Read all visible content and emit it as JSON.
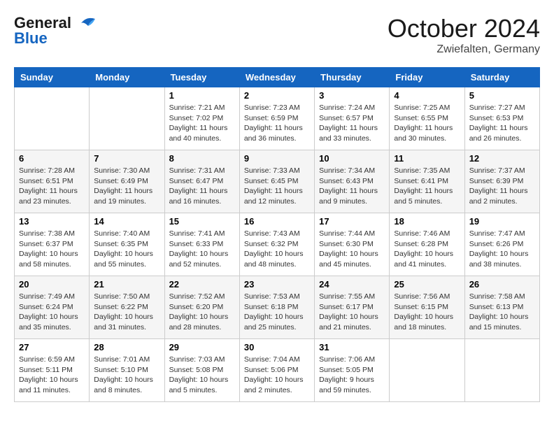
{
  "header": {
    "logo_line1": "General",
    "logo_line2": "Blue",
    "month": "October 2024",
    "location": "Zwiefalten, Germany"
  },
  "days_of_week": [
    "Sunday",
    "Monday",
    "Tuesday",
    "Wednesday",
    "Thursday",
    "Friday",
    "Saturday"
  ],
  "weeks": [
    [
      {
        "day": "",
        "info": ""
      },
      {
        "day": "",
        "info": ""
      },
      {
        "day": "1",
        "info": "Sunrise: 7:21 AM\nSunset: 7:02 PM\nDaylight: 11 hours and 40 minutes."
      },
      {
        "day": "2",
        "info": "Sunrise: 7:23 AM\nSunset: 6:59 PM\nDaylight: 11 hours and 36 minutes."
      },
      {
        "day": "3",
        "info": "Sunrise: 7:24 AM\nSunset: 6:57 PM\nDaylight: 11 hours and 33 minutes."
      },
      {
        "day": "4",
        "info": "Sunrise: 7:25 AM\nSunset: 6:55 PM\nDaylight: 11 hours and 30 minutes."
      },
      {
        "day": "5",
        "info": "Sunrise: 7:27 AM\nSunset: 6:53 PM\nDaylight: 11 hours and 26 minutes."
      }
    ],
    [
      {
        "day": "6",
        "info": "Sunrise: 7:28 AM\nSunset: 6:51 PM\nDaylight: 11 hours and 23 minutes."
      },
      {
        "day": "7",
        "info": "Sunrise: 7:30 AM\nSunset: 6:49 PM\nDaylight: 11 hours and 19 minutes."
      },
      {
        "day": "8",
        "info": "Sunrise: 7:31 AM\nSunset: 6:47 PM\nDaylight: 11 hours and 16 minutes."
      },
      {
        "day": "9",
        "info": "Sunrise: 7:33 AM\nSunset: 6:45 PM\nDaylight: 11 hours and 12 minutes."
      },
      {
        "day": "10",
        "info": "Sunrise: 7:34 AM\nSunset: 6:43 PM\nDaylight: 11 hours and 9 minutes."
      },
      {
        "day": "11",
        "info": "Sunrise: 7:35 AM\nSunset: 6:41 PM\nDaylight: 11 hours and 5 minutes."
      },
      {
        "day": "12",
        "info": "Sunrise: 7:37 AM\nSunset: 6:39 PM\nDaylight: 11 hours and 2 minutes."
      }
    ],
    [
      {
        "day": "13",
        "info": "Sunrise: 7:38 AM\nSunset: 6:37 PM\nDaylight: 10 hours and 58 minutes."
      },
      {
        "day": "14",
        "info": "Sunrise: 7:40 AM\nSunset: 6:35 PM\nDaylight: 10 hours and 55 minutes."
      },
      {
        "day": "15",
        "info": "Sunrise: 7:41 AM\nSunset: 6:33 PM\nDaylight: 10 hours and 52 minutes."
      },
      {
        "day": "16",
        "info": "Sunrise: 7:43 AM\nSunset: 6:32 PM\nDaylight: 10 hours and 48 minutes."
      },
      {
        "day": "17",
        "info": "Sunrise: 7:44 AM\nSunset: 6:30 PM\nDaylight: 10 hours and 45 minutes."
      },
      {
        "day": "18",
        "info": "Sunrise: 7:46 AM\nSunset: 6:28 PM\nDaylight: 10 hours and 41 minutes."
      },
      {
        "day": "19",
        "info": "Sunrise: 7:47 AM\nSunset: 6:26 PM\nDaylight: 10 hours and 38 minutes."
      }
    ],
    [
      {
        "day": "20",
        "info": "Sunrise: 7:49 AM\nSunset: 6:24 PM\nDaylight: 10 hours and 35 minutes."
      },
      {
        "day": "21",
        "info": "Sunrise: 7:50 AM\nSunset: 6:22 PM\nDaylight: 10 hours and 31 minutes."
      },
      {
        "day": "22",
        "info": "Sunrise: 7:52 AM\nSunset: 6:20 PM\nDaylight: 10 hours and 28 minutes."
      },
      {
        "day": "23",
        "info": "Sunrise: 7:53 AM\nSunset: 6:18 PM\nDaylight: 10 hours and 25 minutes."
      },
      {
        "day": "24",
        "info": "Sunrise: 7:55 AM\nSunset: 6:17 PM\nDaylight: 10 hours and 21 minutes."
      },
      {
        "day": "25",
        "info": "Sunrise: 7:56 AM\nSunset: 6:15 PM\nDaylight: 10 hours and 18 minutes."
      },
      {
        "day": "26",
        "info": "Sunrise: 7:58 AM\nSunset: 6:13 PM\nDaylight: 10 hours and 15 minutes."
      }
    ],
    [
      {
        "day": "27",
        "info": "Sunrise: 6:59 AM\nSunset: 5:11 PM\nDaylight: 10 hours and 11 minutes."
      },
      {
        "day": "28",
        "info": "Sunrise: 7:01 AM\nSunset: 5:10 PM\nDaylight: 10 hours and 8 minutes."
      },
      {
        "day": "29",
        "info": "Sunrise: 7:03 AM\nSunset: 5:08 PM\nDaylight: 10 hours and 5 minutes."
      },
      {
        "day": "30",
        "info": "Sunrise: 7:04 AM\nSunset: 5:06 PM\nDaylight: 10 hours and 2 minutes."
      },
      {
        "day": "31",
        "info": "Sunrise: 7:06 AM\nSunset: 5:05 PM\nDaylight: 9 hours and 59 minutes."
      },
      {
        "day": "",
        "info": ""
      },
      {
        "day": "",
        "info": ""
      }
    ]
  ]
}
